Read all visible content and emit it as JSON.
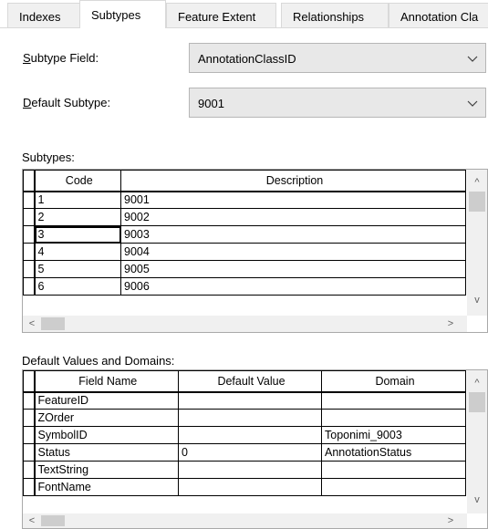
{
  "tabs": [
    {
      "label": "Indexes",
      "active": false
    },
    {
      "label": "Subtypes",
      "active": true
    },
    {
      "label": "Feature Extent",
      "active": false
    },
    {
      "label": "Relationships",
      "active": false
    },
    {
      "label": "Annotation Cla",
      "active": false
    }
  ],
  "subtype_field": {
    "label_access": "S",
    "label_rest": "ubtype Field:",
    "value": "AnnotationClassID"
  },
  "default_subtype": {
    "label_access": "D",
    "label_rest": "efault Subtype:",
    "value": "9001"
  },
  "subtypes": {
    "label": "Subtypes:",
    "columns": [
      "Code",
      "Description"
    ],
    "rows": [
      {
        "code": "1",
        "description": "9001"
      },
      {
        "code": "2",
        "description": "9002"
      },
      {
        "code": "3",
        "description": "9003"
      },
      {
        "code": "4",
        "description": "9004"
      },
      {
        "code": "5",
        "description": "9005"
      },
      {
        "code": "6",
        "description": "9006"
      }
    ]
  },
  "defaults": {
    "label": "Default Values and Domains:",
    "columns": [
      "Field Name",
      "Default Value",
      "Domain"
    ],
    "rows": [
      {
        "field": "FeatureID",
        "default": "",
        "domain": ""
      },
      {
        "field": "ZOrder",
        "default": "",
        "domain": ""
      },
      {
        "field": "SymbolID",
        "default": "",
        "domain": "Toponimi_9003"
      },
      {
        "field": "Status",
        "default": "0",
        "domain": "AnnotationStatus"
      },
      {
        "field": "TextString",
        "default": "",
        "domain": ""
      },
      {
        "field": "FontName",
        "default": "",
        "domain": ""
      }
    ]
  },
  "scroll_glyphs": {
    "up": "^",
    "down": "v",
    "left": "<",
    "right": ">"
  }
}
